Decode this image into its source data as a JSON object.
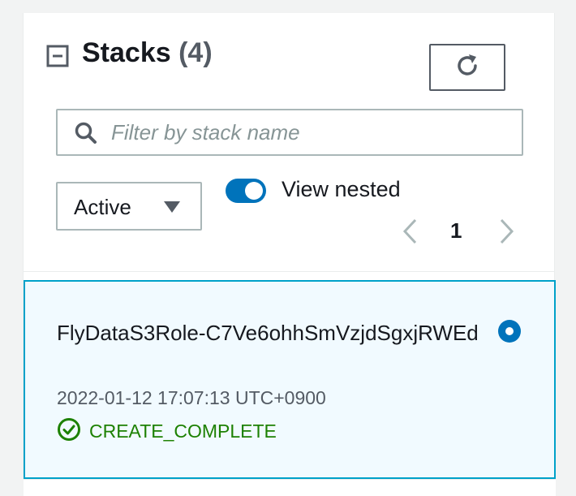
{
  "header": {
    "title": "Stacks",
    "count": "(4)",
    "collapse_icon": "collapse-minus-icon",
    "refresh_icon": "refresh-icon"
  },
  "search": {
    "placeholder": "Filter by stack name",
    "value": "",
    "icon": "search-icon"
  },
  "filter": {
    "selected": "Active",
    "icon": "caret-down-icon"
  },
  "view_nested": {
    "label": "View nested",
    "enabled": true
  },
  "pagination": {
    "current_page": "1",
    "prev_icon": "chevron-left-icon",
    "next_icon": "chevron-right-icon"
  },
  "stacks": [
    {
      "name": "FlyDataS3Role-C7Ve6ohhSmVzjdSgxjRWEd",
      "created": "2022-01-12 17:07:13 UTC+0900",
      "status": "CREATE_COMPLETE",
      "selected": true
    }
  ],
  "colors": {
    "accent": "#0073bb",
    "selected_bg": "#f1faff",
    "selected_border": "#00a1c9",
    "success": "#1d8102",
    "text": "#16191f",
    "muted": "#545b64"
  }
}
